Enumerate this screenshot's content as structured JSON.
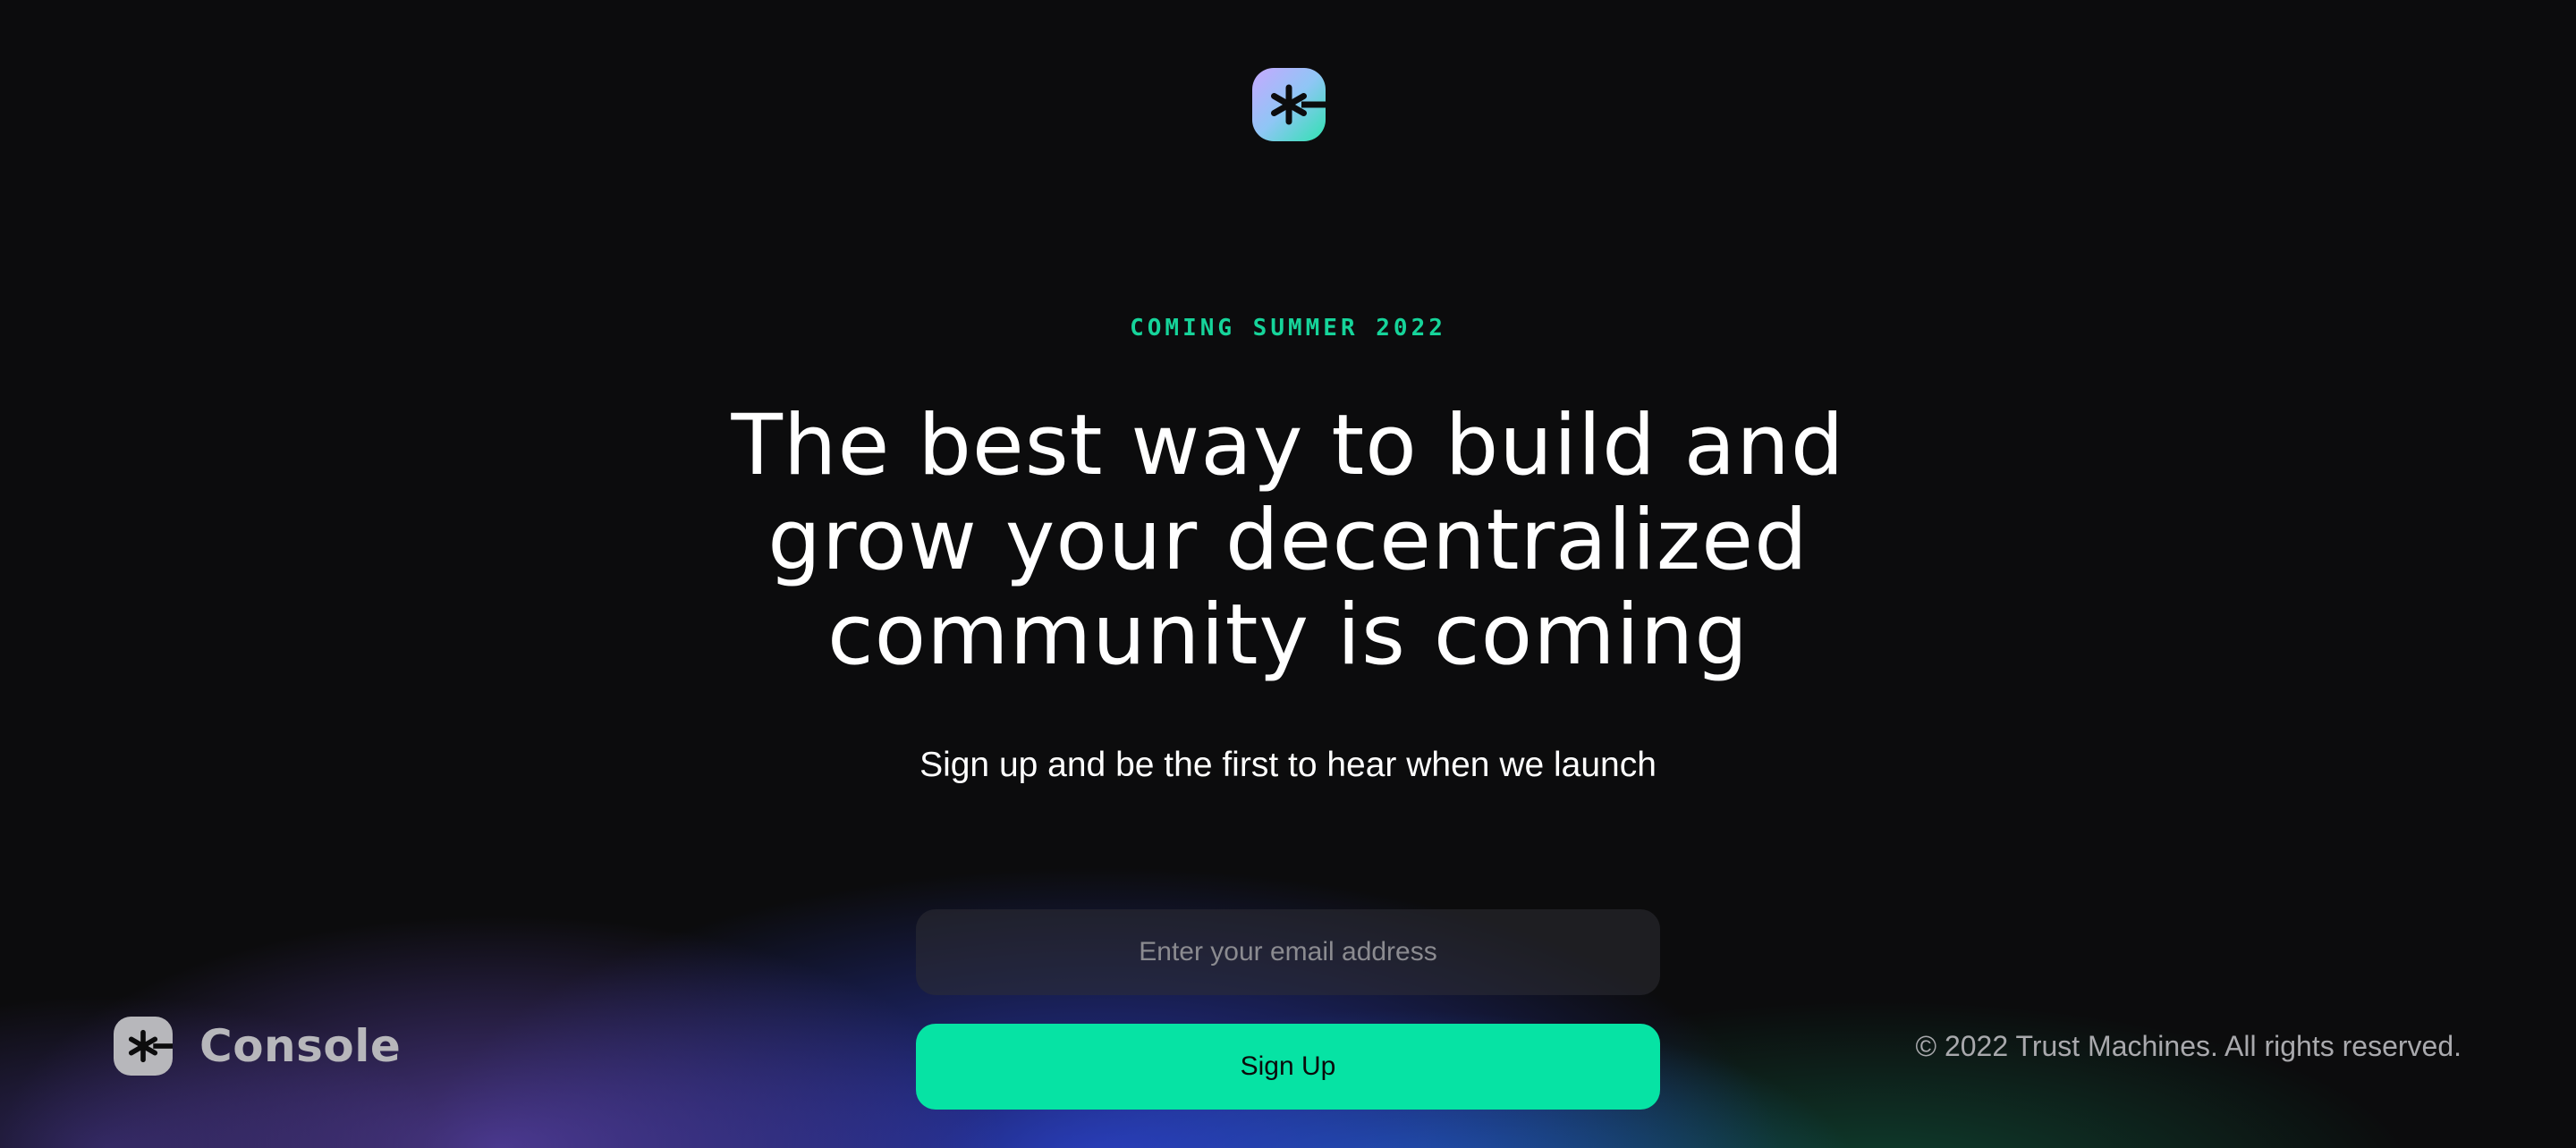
{
  "header": {
    "logo_icon": "asterisk-logo-icon"
  },
  "hero": {
    "eyebrow": "COMING SUMMER 2022",
    "headline_lines": [
      "The best way to build and",
      "grow your decentralized",
      "community is coming"
    ],
    "subhead": "Sign up and be the first to hear when we launch"
  },
  "form": {
    "email_placeholder": "Enter your email address",
    "email_value": "",
    "signup_label": "Sign Up"
  },
  "footer": {
    "brand_icon": "asterisk-logo-icon",
    "brand_name": "Console",
    "copyright": "© 2022 Trust Machines. All rights reserved."
  },
  "colors": {
    "background": "#0c0c0d",
    "accent": "#06e3a4",
    "eyebrow": "#16d49a",
    "text": "#ffffff",
    "muted": "#a9a9ad"
  }
}
